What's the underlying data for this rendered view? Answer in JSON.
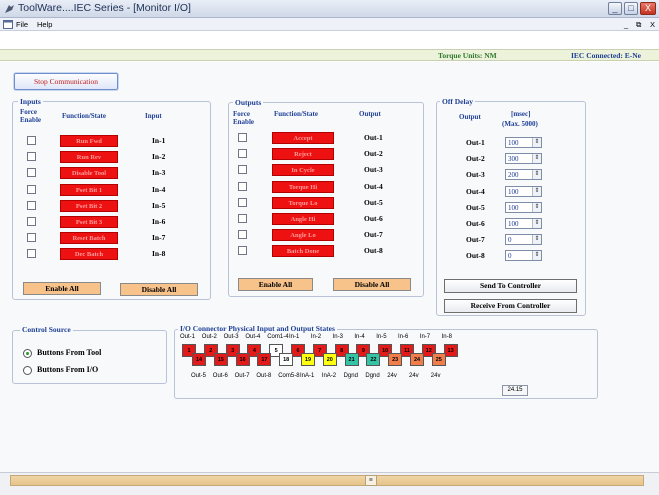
{
  "window": {
    "title": "ToolWare....IEC Series - [Monitor I/O]",
    "buttons": [
      "_",
      "□",
      "X"
    ],
    "mdi_buttons": [
      "_",
      "⧉",
      "X"
    ]
  },
  "menu": [
    "File",
    "Help"
  ],
  "status": {
    "torque_units": "Torque Units: NM",
    "connection": "IEC Connected: E-Ne"
  },
  "stop_button": "Stop Communication",
  "inputs": {
    "group_title": "Inputs",
    "header_force": "Force\nEnable",
    "header_function": "Function/State",
    "header_io": "Input",
    "rows": [
      {
        "func": "Run Fwd",
        "io": "In-1"
      },
      {
        "func": "Run Rev",
        "io": "In-2"
      },
      {
        "func": "Disable Tool",
        "io": "In-3"
      },
      {
        "func": "Pset Bit 1",
        "io": "In-4"
      },
      {
        "func": "Pset Bit 2",
        "io": "In-5"
      },
      {
        "func": "Pset Bit 3",
        "io": "In-6"
      },
      {
        "func": "Reset Batch",
        "io": "In-7"
      },
      {
        "func": "Dec Batch",
        "io": "In-8"
      }
    ],
    "enable_all": "Enable All",
    "disable_all": "Disable All"
  },
  "outputs": {
    "group_title": "Outputs",
    "header_force": "Force\nEnable",
    "header_function": "Function/State",
    "header_io": "Output",
    "rows": [
      {
        "func": "Accept",
        "io": "Out-1"
      },
      {
        "func": "Reject",
        "io": "Out-2"
      },
      {
        "func": "In Cycle",
        "io": "Out-3"
      },
      {
        "func": "Torque Hi",
        "io": "Out-4"
      },
      {
        "func": "Torque Lo",
        "io": "Out-5"
      },
      {
        "func": "Angle Hi",
        "io": "Out-6"
      },
      {
        "func": "Angle Lo",
        "io": "Out-7"
      },
      {
        "func": "Batch Done",
        "io": "Out-8"
      }
    ],
    "enable_all": "Enable All",
    "disable_all": "Disable All"
  },
  "off_delay": {
    "group_title": "Off Delay",
    "header_output": "Output",
    "header_msec": "[msec]",
    "header_max": "(Max. 5000)",
    "rows": [
      {
        "io": "Out-1",
        "value": "100"
      },
      {
        "io": "Out-2",
        "value": "300"
      },
      {
        "io": "Out-3",
        "value": "200"
      },
      {
        "io": "Out-4",
        "value": "100"
      },
      {
        "io": "Out-5",
        "value": "100"
      },
      {
        "io": "Out-6",
        "value": "100"
      },
      {
        "io": "Out-7",
        "value": "0"
      },
      {
        "io": "Out-8",
        "value": "0"
      }
    ],
    "send": "Send To Controller",
    "receive": "Receive From Controller"
  },
  "control_source": {
    "group_title": "Control Source",
    "options": [
      "Buttons From Tool",
      "Buttons From I/O"
    ],
    "selected": 0
  },
  "connector": {
    "group_title": "I/O Connector Physical Input and Output States",
    "top_labels": [
      "Out-1",
      "Out-2",
      "Out-3",
      "Out-4",
      "Com1-4",
      "In-1",
      "In-2",
      "In-3",
      "In-4",
      "In-5",
      "In-6",
      "In-7",
      "In-8"
    ],
    "top_pins": [
      {
        "n": "1",
        "color": "#e21a1a"
      },
      {
        "n": "2",
        "color": "#e21a1a"
      },
      {
        "n": "3",
        "color": "#e21a1a"
      },
      {
        "n": "4",
        "color": "#e21a1a"
      },
      {
        "n": "5",
        "color": "#ffffff"
      },
      {
        "n": "6",
        "color": "#e21a1a"
      },
      {
        "n": "7",
        "color": "#e21a1a"
      },
      {
        "n": "8",
        "color": "#e21a1a"
      },
      {
        "n": "9",
        "color": "#e21a1a"
      },
      {
        "n": "10",
        "color": "#e21a1a"
      },
      {
        "n": "11",
        "color": "#e21a1a"
      },
      {
        "n": "12",
        "color": "#e21a1a"
      },
      {
        "n": "13",
        "color": "#e21a1a"
      }
    ],
    "bottom_pins": [
      {
        "n": "14",
        "color": "#e21a1a"
      },
      {
        "n": "15",
        "color": "#e21a1a"
      },
      {
        "n": "16",
        "color": "#e21a1a"
      },
      {
        "n": "17",
        "color": "#e21a1a"
      },
      {
        "n": "18",
        "color": "#ffffff"
      },
      {
        "n": "19",
        "color": "#ffff10"
      },
      {
        "n": "20",
        "color": "#ffff10"
      },
      {
        "n": "21",
        "color": "#33c4a6"
      },
      {
        "n": "22",
        "color": "#33c4a6"
      },
      {
        "n": "23",
        "color": "#f07d4a"
      },
      {
        "n": "24",
        "color": "#f07d4a"
      },
      {
        "n": "25",
        "color": "#f07d4a"
      }
    ],
    "bottom_labels": [
      "Out-5",
      "Out-6",
      "Out-7",
      "Out-8",
      "Com5-8",
      "InA-1",
      "InA-2",
      "Dgnd",
      "Dgnd",
      "24v",
      "24v",
      "24v"
    ],
    "voltage": "24.15"
  },
  "scroll_thumb": "≡"
}
